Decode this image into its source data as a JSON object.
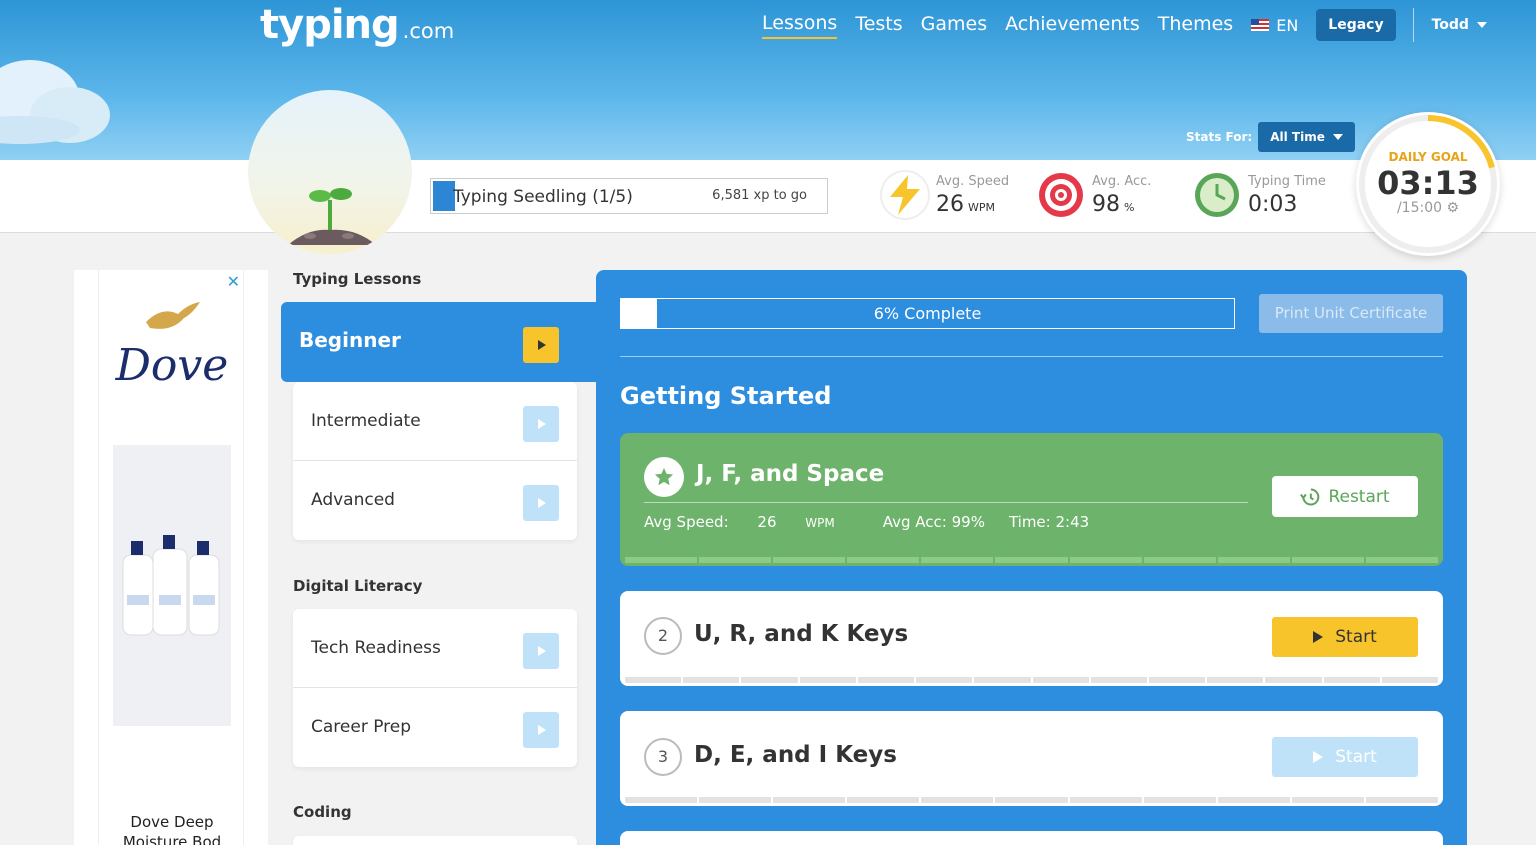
{
  "header": {
    "logo_main": "typing",
    "logo_suffix": ".com",
    "nav": [
      "Lessons",
      "Tests",
      "Games",
      "Achievements",
      "Themes"
    ],
    "active_nav": "Lessons",
    "language": "EN",
    "legacy_label": "Legacy",
    "user_name": "Todd"
  },
  "stats_filter": {
    "label": "Stats For:",
    "selected": "All Time"
  },
  "level": {
    "name": "Typing Seedling (1/5)",
    "xp_to_go": "6,581 xp to go"
  },
  "stats": {
    "speed": {
      "label": "Avg. Speed",
      "value": "26",
      "unit": "WPM"
    },
    "accuracy": {
      "label": "Avg. Acc.",
      "value": "98",
      "unit": "%"
    },
    "typing_time": {
      "label": "Typing Time",
      "value": "0:03"
    }
  },
  "daily_goal": {
    "label": "DAILY GOAL",
    "time": "03:13",
    "total": "/15:00",
    "progress_fraction": 0.21
  },
  "ad": {
    "brand": "Dove",
    "caption": "Dove Deep Moisture Bod"
  },
  "sidebar": {
    "typing_lessons_title": "Typing Lessons",
    "typing_lessons": [
      "Beginner",
      "Intermediate",
      "Advanced"
    ],
    "digital_literacy_title": "Digital Literacy",
    "digital_literacy": [
      "Tech Readiness",
      "Career Prep"
    ],
    "coding_title": "Coding"
  },
  "unit": {
    "progress_text": "6% Complete",
    "progress_fraction": 0.06,
    "print_certificate": "Print Unit Certificate",
    "title": "Getting Started"
  },
  "lessons": [
    {
      "name": "J, F, and Space",
      "completed": true,
      "avg_speed_label": "Avg Speed:",
      "avg_speed_value": "26",
      "avg_speed_unit": "WPM",
      "avg_acc": "Avg Acc: 99%",
      "time": "Time: 2:43",
      "action": "Restart"
    },
    {
      "number": "2",
      "name": "U, R, and K Keys",
      "action": "Start",
      "enabled": true
    },
    {
      "number": "3",
      "name": "D, E, and I Keys",
      "action": "Start",
      "enabled": false
    }
  ],
  "colors": {
    "header_blue": "#2d95d6",
    "panel_blue": "#2d8ee0",
    "accent_yellow": "#f7c52b",
    "complete_green": "#6db36b"
  }
}
